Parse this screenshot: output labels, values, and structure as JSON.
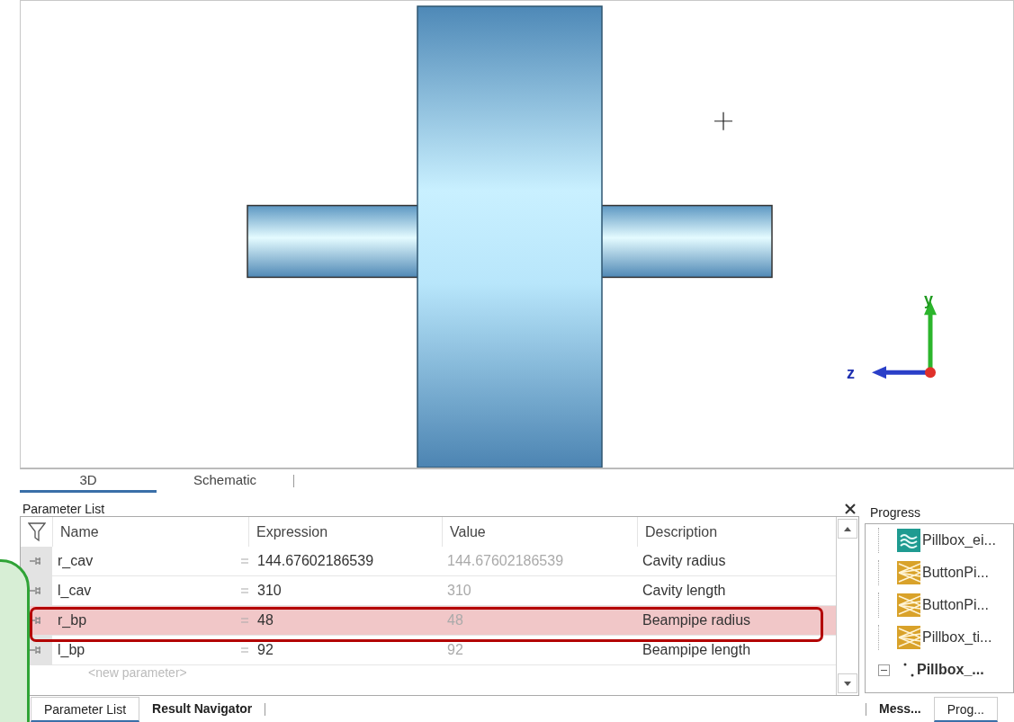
{
  "viewport": {
    "axis_labels": [
      "y",
      "z"
    ]
  },
  "viewport_tabs": [
    {
      "label": "3D",
      "selected": true
    },
    {
      "label": "Schematic",
      "selected": false
    }
  ],
  "parameter_list": {
    "title": "Parameter List",
    "columns": [
      "Name",
      "Expression",
      "Value",
      "Description"
    ],
    "rows": [
      {
        "name": "r_cav",
        "expression": "144.67602186539",
        "value": "144.67602186539",
        "description": "Cavity radius",
        "selected": false
      },
      {
        "name": "l_cav",
        "expression": "310",
        "value": "310",
        "description": "Cavity length",
        "selected": false
      },
      {
        "name": "r_bp",
        "expression": "48",
        "value": "48",
        "description": "Beampipe radius",
        "selected": true
      },
      {
        "name": "l_bp",
        "expression": "92",
        "value": "92",
        "description": "Beampipe length",
        "selected": false
      }
    ],
    "new_row_placeholder": "<new parameter>"
  },
  "progress": {
    "title": "Progress",
    "items": [
      {
        "label": "Pillbox_ei...",
        "kind": "wave"
      },
      {
        "label": "ButtonPi...",
        "kind": "fan"
      },
      {
        "label": "ButtonPi...",
        "kind": "fan"
      },
      {
        "label": "Pillbox_ti...",
        "kind": "fan"
      },
      {
        "label": "Pillbox_...",
        "kind": "group",
        "expanded": true
      }
    ]
  },
  "bottom_tabs_left": [
    {
      "label": "Parameter List",
      "selected": true
    },
    {
      "label": "Result Navigator",
      "selected": false
    }
  ],
  "bottom_tabs_right": [
    {
      "label": "Mess...",
      "selected": false
    },
    {
      "label": "Prog...",
      "selected": true
    }
  ]
}
